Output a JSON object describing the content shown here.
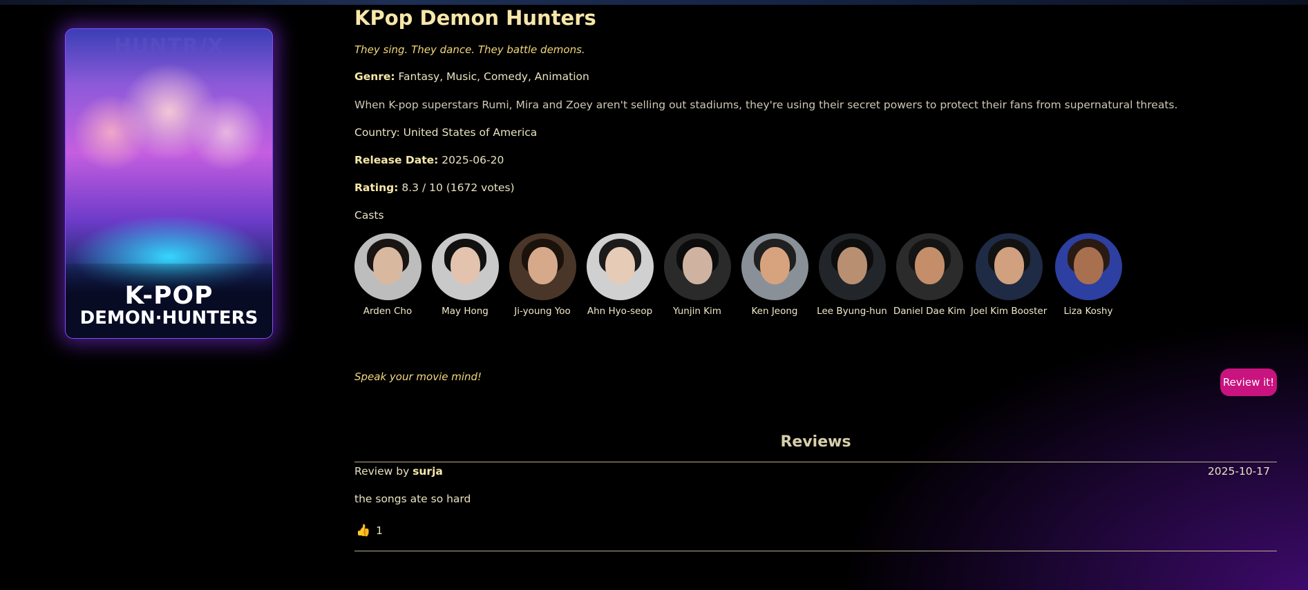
{
  "poster": {
    "top_text": "HUNTR/X",
    "logo_line1": "K-POP",
    "logo_line2": "DEMON·HUNTERS"
  },
  "movie": {
    "title": "KPop Demon Hunters",
    "tagline": "They sing. They dance. They battle demons.",
    "genre_label": "Genre:",
    "genre": " Fantasy, Music, Comedy, Animation",
    "description": "When K-pop superstars Rumi, Mira and Zoey aren't selling out stadiums, they're using their secret powers to protect their fans from supernatural threats.",
    "country": "Country: United States of America",
    "release_label": "Release Date:",
    "release_date": " 2025-06-20",
    "rating_label": "Rating:",
    "rating": " 8.3 / 10 (1672 votes)"
  },
  "casts_heading": "Casts",
  "casts": [
    {
      "name": "Arden Cho"
    },
    {
      "name": "May Hong"
    },
    {
      "name": "Ji-young Yoo"
    },
    {
      "name": "Ahn Hyo-seop"
    },
    {
      "name": "Yunjin Kim"
    },
    {
      "name": "Ken Jeong"
    },
    {
      "name": "Lee Byung-hun"
    },
    {
      "name": "Daniel Dae Kim"
    },
    {
      "name": "Joel Kim Booster"
    },
    {
      "name": "Liza Koshy"
    }
  ],
  "review_prompt": "Speak your movie mind!",
  "review_button": "Review it!",
  "reviews_heading": "Reviews",
  "reviews": [
    {
      "by_label": "Review by ",
      "author": "surja",
      "date": "2025-10-17",
      "text": "the songs ate so hard",
      "likes": "1",
      "like_icon": "thumbs-up-icon"
    }
  ],
  "colors": {
    "accent": "#c9137f",
    "title": "#f6e7a9",
    "tagline": "#f4d77a",
    "poster_glow": "#8a4dff"
  }
}
